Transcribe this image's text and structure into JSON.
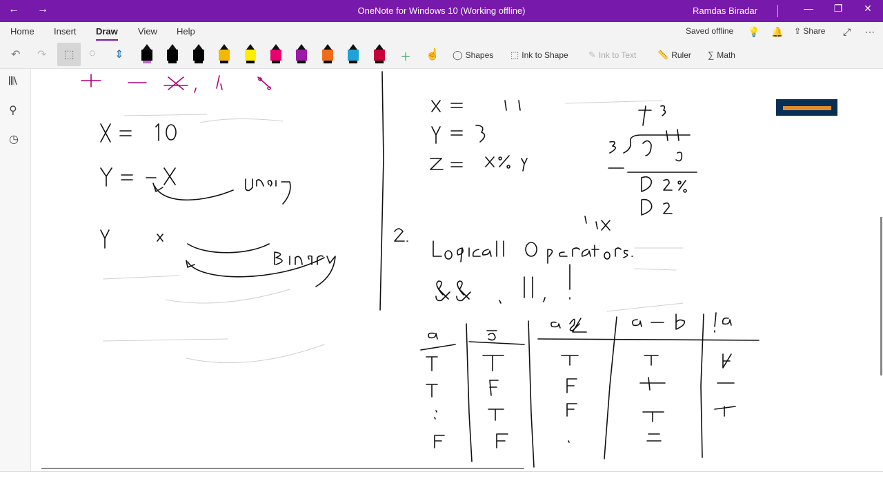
{
  "window": {
    "title": "OneNote for Windows 10 (Working offline)",
    "user": "Ramdas Biradar",
    "back_icon": "←",
    "forward_icon": "→",
    "min_icon": "—",
    "max_icon": "❐",
    "close_icon": "✕"
  },
  "menu": {
    "tabs": [
      "Home",
      "Insert",
      "Draw",
      "View",
      "Help"
    ],
    "active_tab": "Draw",
    "saved_status": "Saved offline",
    "share_label": "Share"
  },
  "toolbar": {
    "shapes_label": "Shapes",
    "ink_to_shape_label": "Ink to Shape",
    "ink_to_text_label": "Ink to Text",
    "ruler_label": "Ruler",
    "math_label": "Math",
    "pens": [
      {
        "name": "pen-1",
        "color": "#000000",
        "band": "#c06ad0"
      },
      {
        "name": "pen-2",
        "color": "#000000",
        "band": "#000000"
      },
      {
        "name": "pen-3",
        "color": "#000000",
        "band": "#000000"
      },
      {
        "name": "pen-4",
        "color": "#f5b800",
        "band": "#000000"
      },
      {
        "name": "highlighter",
        "color": "#ffee00",
        "band": "#000000"
      },
      {
        "name": "pen-6",
        "color": "#e8006f",
        "band": "#000000"
      },
      {
        "name": "pen-7",
        "color": "#9b1aa8",
        "band": "#000000"
      },
      {
        "name": "pen-8",
        "color": "#ef6c1b",
        "band": "#000000"
      },
      {
        "name": "pen-9",
        "color": "#1fa2d8",
        "band": "#000000"
      },
      {
        "name": "pen-10",
        "color": "#c8003c",
        "band": "#000000"
      }
    ]
  },
  "page": {
    "ink_strokes": [
      "+, -, *, /, %",
      "x = 10",
      "y = -x",
      "Unary",
      "y x",
      "Binary",
      "x = 11",
      "y = 3",
      "z = x % y",
      "3 ) 9 11",
      "2 %",
      "2",
      "2.",
      "Logical Operators.",
      "&& , || , !",
      "a",
      "b",
      "a && b",
      "a || b",
      "!a",
      "T",
      "F"
    ]
  },
  "colors": {
    "accent": "#7719aa",
    "ink_black": "#111111",
    "ink_magenta": "#b0007a"
  }
}
